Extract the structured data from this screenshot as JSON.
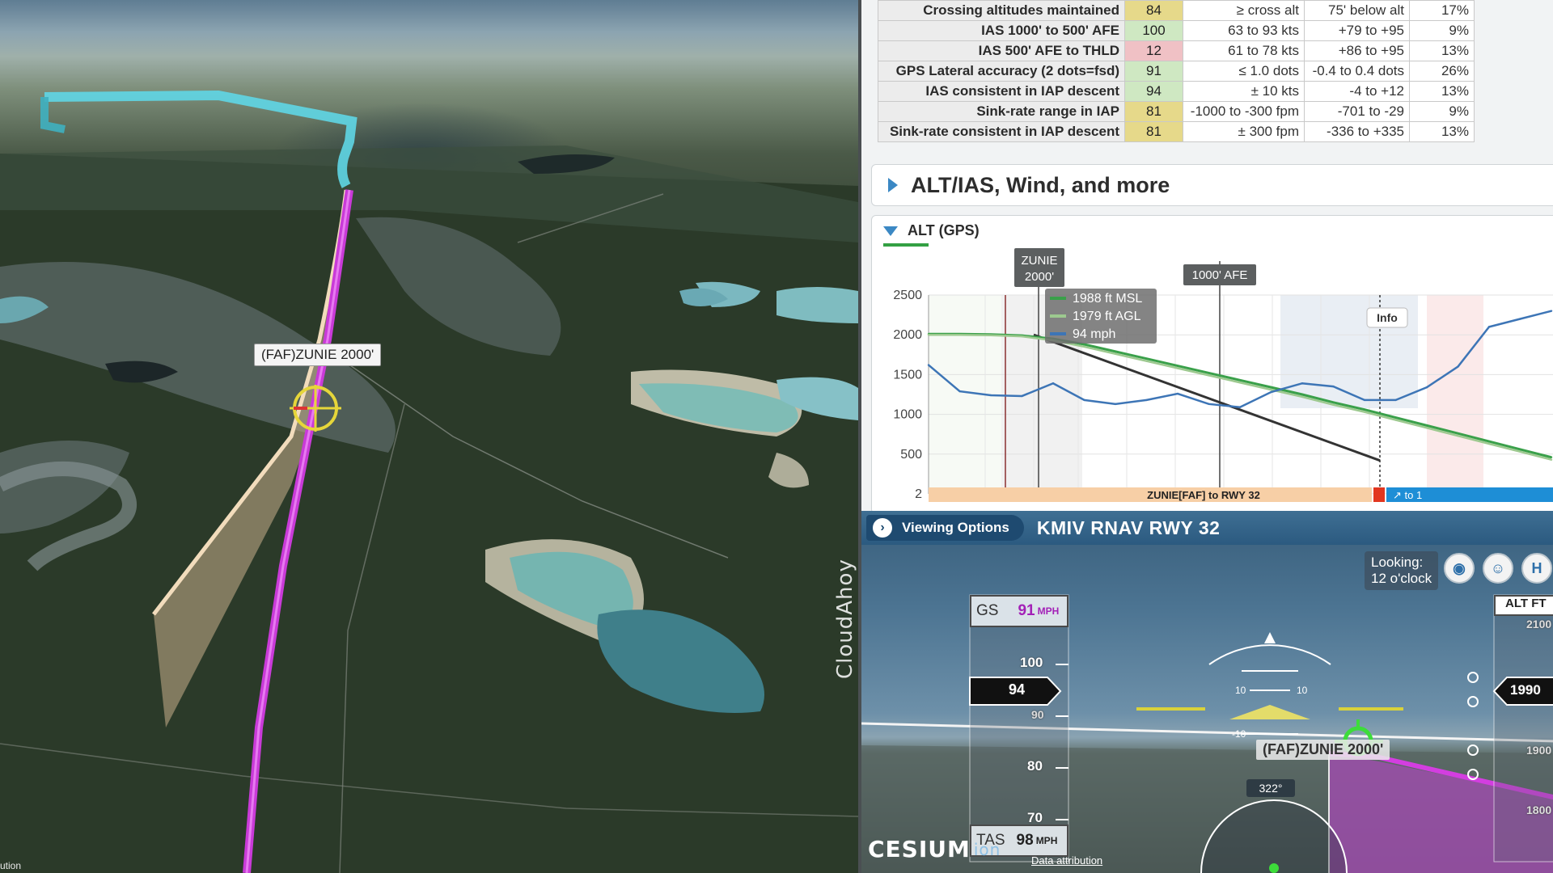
{
  "map": {
    "waypoint_label": "(FAF)ZUNIE 2000'",
    "logo": "CloudAhoy",
    "attribution_fragment": "ution"
  },
  "scores_table": {
    "rows": [
      {
        "name": "Crossing altitudes maintained",
        "score": "84",
        "standard": "≥ cross alt",
        "actual": "75' below alt",
        "weight": "17%",
        "color": "#e6d98a"
      },
      {
        "name": "IAS 1000' to 500' AFE",
        "score": "100",
        "standard": "63 to 93 kts",
        "actual": "+79 to +95",
        "weight": "9%",
        "color": "#cfe8c2"
      },
      {
        "name": "IAS 500' AFE to THLD",
        "score": "12",
        "standard": "61 to 78 kts",
        "actual": "+86 to +95",
        "weight": "13%",
        "color": "#f0c1c5"
      },
      {
        "name": "GPS Lateral accuracy (2 dots=fsd)",
        "score": "91",
        "standard": "≤ 1.0 dots",
        "actual": "-0.4 to 0.4 dots",
        "weight": "26%",
        "color": "#cfe8c2"
      },
      {
        "name": "IAS consistent in IAP descent",
        "score": "94",
        "standard": "± 10 kts",
        "actual": "-4 to +12",
        "weight": "13%",
        "color": "#cfe8c2"
      },
      {
        "name": "Sink-rate range in IAP",
        "score": "81",
        "standard": "-1000 to -300 fpm",
        "actual": "-701 to -29",
        "weight": "9%",
        "color": "#e6d98a"
      },
      {
        "name": "Sink-rate consistent in IAP descent",
        "score": "81",
        "standard": "± 300 fpm",
        "actual": "-336 to +335",
        "weight": "13%",
        "color": "#e6d98a"
      }
    ]
  },
  "section": {
    "title": "ALT/IAS, Wind, and more"
  },
  "alt_chart": {
    "header": "ALT (GPS)",
    "zunie_tag_line1": "ZUNIE",
    "zunie_tag_line2": "2000'",
    "afe_tag": "1000' AFE",
    "tooltip": [
      "1988 ft MSL",
      "1979 ft AGL",
      "94 mph"
    ],
    "info_btn": "Info",
    "segment_label": "ZUNIE[FAF] to RWY 32",
    "next_label": "↗ to 1",
    "colors": {
      "msl": "#3aa04a",
      "agl": "#9dc98f",
      "ias": "#3d75b6",
      "glide": "#333333"
    }
  },
  "chart_data": {
    "type": "line",
    "title": "ALT (GPS)",
    "yticks": [
      2500,
      2000,
      1500,
      1000,
      500,
      2
    ],
    "ylim": [
      0,
      2600
    ],
    "x": [
      0,
      5,
      10,
      15,
      20,
      25,
      30,
      35,
      40,
      45,
      50,
      55,
      60,
      65,
      70,
      75,
      80,
      85,
      90,
      95,
      100
    ],
    "series": [
      {
        "values": [
          2010,
          2010,
          2005,
          1990,
          1950,
          1880,
          1790,
          1700,
          1610,
          1520,
          1430,
          1340,
          1250,
          1150,
          1060,
          960,
          860,
          760,
          660,
          560,
          460
        ],
        "color": "#3aa04a"
      },
      {
        "values": [
          2000,
          2000,
          1995,
          1980,
          1930,
          1850,
          1760,
          1670,
          1580,
          1490,
          1400,
          1310,
          1220,
          1120,
          1030,
          930,
          830,
          730,
          630,
          530,
          430
        ],
        "color": "#9dc98f"
      },
      {
        "values": [
          1620,
          1290,
          1240,
          1230,
          1390,
          1180,
          1130,
          1180,
          1260,
          1130,
          1090,
          1280,
          1390,
          1350,
          1180,
          1180,
          1340,
          1600,
          2100,
          2200,
          2300
        ],
        "color": "#3d75b6"
      }
    ]
  },
  "view3d": {
    "viewing_options": "Viewing Options",
    "approach_title": "KMIV RNAV RWY 32",
    "looking_line1": "Looking:",
    "looking_line2": "12 o'clock",
    "gs_label": "GS",
    "gs_value": "91",
    "gs_unit": "MPH",
    "tas_label": "TAS",
    "tas_value": "98",
    "tas_unit": "MPH",
    "speed_ticks": [
      "100",
      "90",
      "80",
      "70"
    ],
    "current_speed": "94",
    "alt_header": "ALT FT",
    "current_alt": "1990",
    "alt_ticks": [
      "2100",
      "1900",
      "1800"
    ],
    "heading": "322°",
    "waypoint": "(FAF)ZUNIE 2000'",
    "cesium": "CESIUM",
    "cesium_ion": "ion",
    "data_attribution": "Data attribution",
    "btn_h": "H"
  }
}
